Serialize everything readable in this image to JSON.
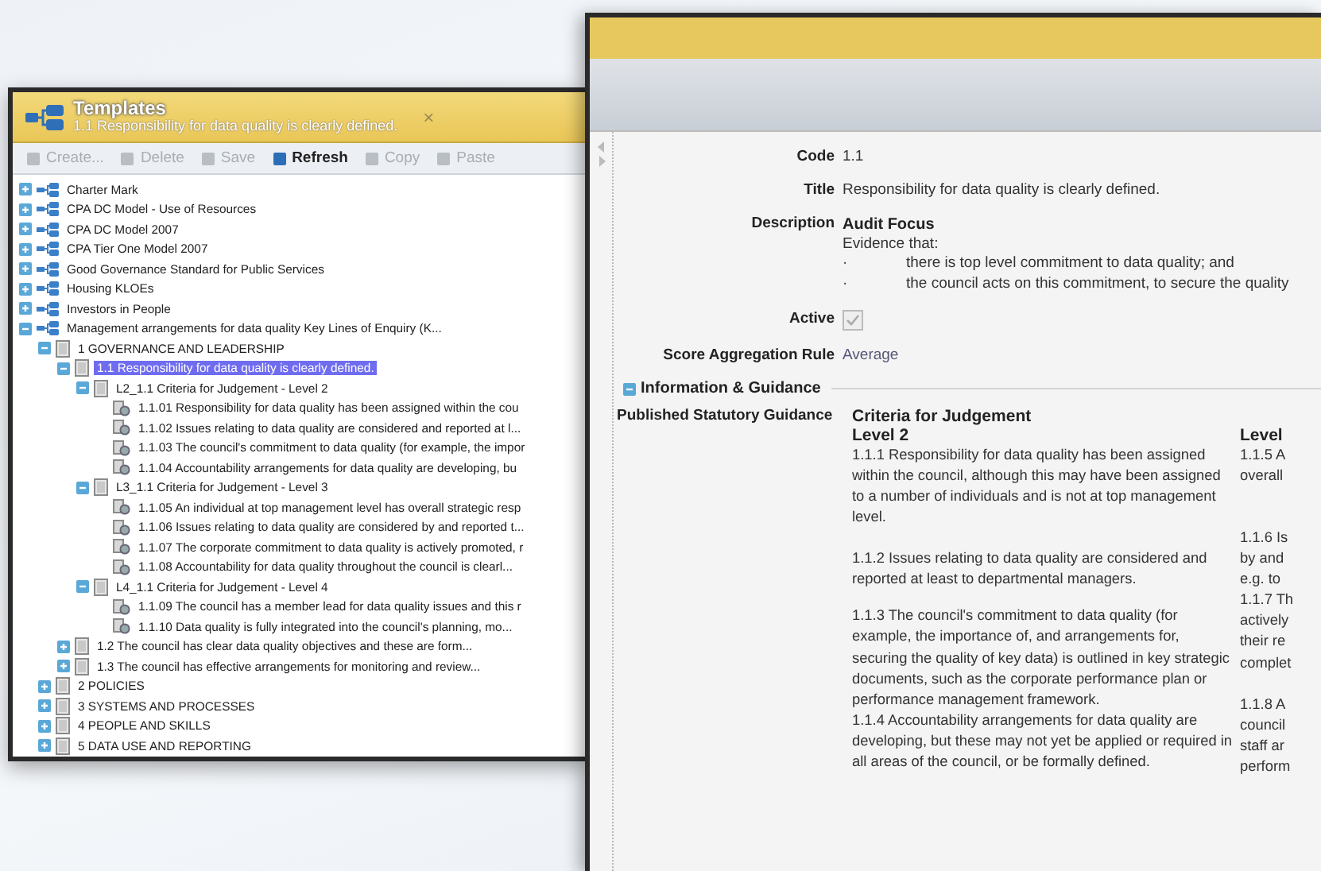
{
  "templates_window": {
    "title": "Templates",
    "subtitle": "1.1 Responsibility for data quality is clearly defined.",
    "close": "×",
    "toolbar": [
      {
        "label": "Create...",
        "disabled": true
      },
      {
        "label": "Delete",
        "disabled": true
      },
      {
        "label": "Save",
        "disabled": true
      },
      {
        "label": "Refresh",
        "disabled": false
      },
      {
        "label": "Copy",
        "disabled": true
      },
      {
        "label": "Paste",
        "disabled": true
      }
    ],
    "tree": [
      {
        "kind": "template",
        "label": "Charter Mark",
        "expanded": false,
        "selected": false
      },
      {
        "kind": "template",
        "label": "CPA DC Model - Use of Resources",
        "expanded": false,
        "selected": false
      },
      {
        "kind": "template",
        "label": "CPA DC Model 2007",
        "expanded": false,
        "selected": false
      },
      {
        "kind": "template",
        "label": "CPA Tier One Model 2007",
        "expanded": false,
        "selected": false
      },
      {
        "kind": "template",
        "label": "Good Governance Standard for Public Services",
        "expanded": false,
        "selected": false
      },
      {
        "kind": "template",
        "label": "Housing KLOEs",
        "expanded": false,
        "selected": false
      },
      {
        "kind": "template",
        "label": "Investors in People",
        "expanded": false,
        "selected": false
      },
      {
        "kind": "template",
        "label": "Management arrangements for data quality Key Lines of Enquiry (K...",
        "expanded": true,
        "selected": false,
        "children": [
          {
            "kind": "section",
            "label": "1 GOVERNANCE AND LEADERSHIP",
            "expanded": true,
            "selected": false,
            "children": [
              {
                "kind": "section",
                "label": "1.1 Responsibility for data quality is clearly defined.",
                "expanded": true,
                "selected": true,
                "children": [
                  {
                    "kind": "section",
                    "label": "L2_1.1 Criteria for Judgement - Level 2",
                    "expanded": true,
                    "selected": false,
                    "children": [
                      {
                        "kind": "criterion",
                        "label": "1.1.01 Responsibility for data quality has been assigned within the cou",
                        "selected": false
                      },
                      {
                        "kind": "criterion",
                        "label": "1.1.02 Issues relating to data quality are considered and reported at l...",
                        "selected": false
                      },
                      {
                        "kind": "criterion",
                        "label": "1.1.03 The council's commitment to data quality (for example, the impor",
                        "selected": false
                      },
                      {
                        "kind": "criterion",
                        "label": "1.1.04 Accountability arrangements for data quality are developing, bu",
                        "selected": false
                      }
                    ]
                  },
                  {
                    "kind": "section",
                    "label": "L3_1.1 Criteria for Judgement - Level 3",
                    "expanded": true,
                    "selected": false,
                    "children": [
                      {
                        "kind": "criterion",
                        "label": "1.1.05 An individual at top management level has overall strategic resp",
                        "selected": false
                      },
                      {
                        "kind": "criterion",
                        "label": "1.1.06 Issues relating to data quality are considered by and reported t...",
                        "selected": false
                      },
                      {
                        "kind": "criterion",
                        "label": "1.1.07 The corporate commitment to data quality is actively promoted, r",
                        "selected": false
                      },
                      {
                        "kind": "criterion",
                        "label": "1.1.08 Accountability for data quality throughout the council is clearl...",
                        "selected": false
                      }
                    ]
                  },
                  {
                    "kind": "section",
                    "label": "L4_1.1 Criteria for Judgement - Level 4",
                    "expanded": true,
                    "selected": false,
                    "children": [
                      {
                        "kind": "criterion",
                        "label": "1.1.09 The council has a member lead for data quality issues and this r",
                        "selected": false
                      },
                      {
                        "kind": "criterion",
                        "label": "1.1.10 Data quality is fully integrated into the council's planning, mo...",
                        "selected": false
                      }
                    ]
                  }
                ]
              },
              {
                "kind": "section",
                "label": "1.2 The council has clear data quality objectives and these are form...",
                "expanded": false,
                "selected": false
              },
              {
                "kind": "section",
                "label": "1.3 The council has effective arrangements for monitoring and review...",
                "expanded": false,
                "selected": false
              }
            ]
          },
          {
            "kind": "section",
            "label": "2 POLICIES",
            "expanded": false,
            "selected": false
          },
          {
            "kind": "section",
            "label": "3 SYSTEMS AND PROCESSES",
            "expanded": false,
            "selected": false
          },
          {
            "kind": "section",
            "label": "4 PEOPLE AND SKILLS",
            "expanded": false,
            "selected": false
          },
          {
            "kind": "section",
            "label": "5 DATA USE AND REPORTING",
            "expanded": false,
            "selected": false
          }
        ]
      }
    ]
  },
  "detail_window": {
    "code": {
      "label": "Code",
      "value": "1.1"
    },
    "title": {
      "label": "Title",
      "value": "Responsibility for data quality is clearly defined."
    },
    "description": {
      "label": "Description",
      "heading": "Audit Focus",
      "intro": "Evidence that:",
      "bullets": [
        {
          "mark": "·",
          "text": "there is top level commitment to data quality; and"
        },
        {
          "mark": "·",
          "text": "the council acts on this commitment, to secure the quality"
        }
      ]
    },
    "active": {
      "label": "Active",
      "checked": true
    },
    "score_rule": {
      "label": "Score Aggregation Rule",
      "value": "Average"
    },
    "section": {
      "title": "Information & Guidance",
      "expanded": true
    },
    "guidance": {
      "label": "Published Statutory Guidance",
      "heading": "Criteria for Judgement",
      "column_1": {
        "heading": "Level 2",
        "paragraphs": [
          "1.1.1 Responsibility for data quality has been assigned within the council, although this may have been assigned to a number of individuals and is not at top management level.",
          "1.1.2 Issues relating to data quality are considered and reported at least to departmental managers.",
          "1.1.3 The council's commitment to data quality (for example, the importance of, and arrangements for, securing the quality of key data) is outlined in key strategic documents, such as the corporate performance plan or performance management framework.",
          "1.1.4 Accountability arrangements for data quality are developing, but these may not yet be applied or required in all areas of the council, or be formally defined."
        ]
      },
      "column_2": {
        "heading": "Level",
        "paragraphs": [
          [
            "1.1.5 A",
            "overall"
          ],
          [
            "1.1.6 Is",
            "by and",
            "e.g. to"
          ],
          [
            "1.1.7 Th",
            "actively",
            "their re",
            "complet"
          ],
          [
            "1.1.8 A",
            "council",
            "staff ar",
            "perform"
          ]
        ]
      }
    }
  }
}
